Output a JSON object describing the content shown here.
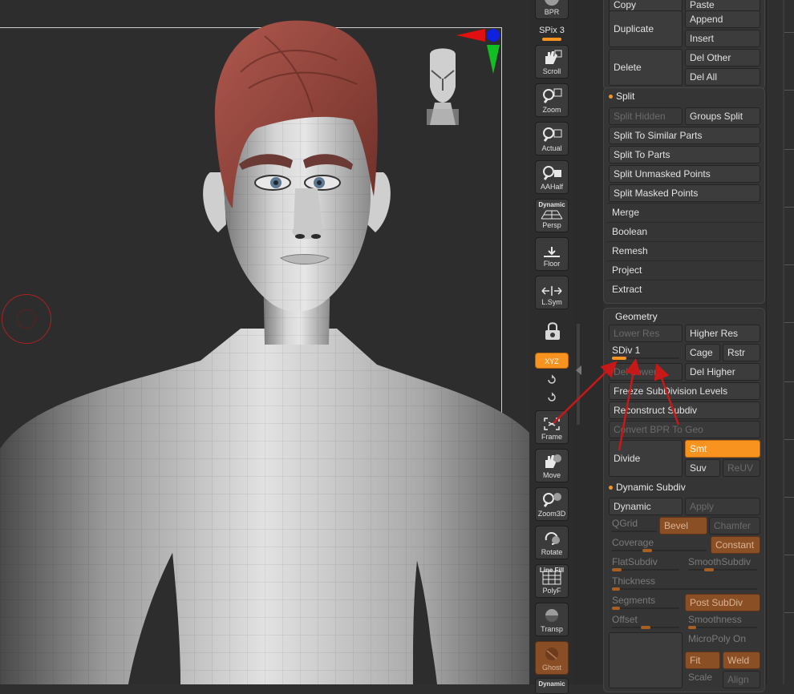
{
  "toolbar": {
    "bpr": "BPR",
    "spix": "SPix 3",
    "scroll": "Scroll",
    "zoom": "Zoom",
    "actual": "Actual",
    "aahalf": "AAHalf",
    "persp_top": "Dynamic",
    "persp": "Persp",
    "floor": "Floor",
    "lsym": "L.Sym",
    "xyz": "XYZ",
    "frame": "Frame",
    "move": "Move",
    "zoom3d": "Zoom3D",
    "rotate": "Rotate",
    "polyf_top": "Line Fill",
    "polyf": "PolyF",
    "transp": "Transp",
    "ghost": "Ghost",
    "dynamic_bottom": "Dynamic"
  },
  "tool": {
    "copy": "Copy",
    "paste": "Paste",
    "duplicate": "Duplicate",
    "append": "Append",
    "insert": "Insert",
    "delete": "Delete",
    "del_other": "Del Other",
    "del_all": "Del All",
    "split": {
      "title": "Split",
      "split_hidden": "Split Hidden",
      "groups_split": "Groups Split",
      "similar_parts": "Split To Similar Parts",
      "to_parts": "Split To Parts",
      "unmasked_points": "Split Unmasked Points",
      "masked_points": "Split Masked Points"
    },
    "items": [
      "Merge",
      "Boolean",
      "Remesh",
      "Project",
      "Extract"
    ],
    "geometry": {
      "title": "Geometry",
      "lower_res": "Lower Res",
      "higher_res": "Higher Res",
      "sdiv": "SDiv 1",
      "sdiv_level": 1,
      "cage": "Cage",
      "rstr": "Rstr",
      "del_lower": "Del Lower",
      "del_higher": "Del Higher",
      "freeze": "Freeze SubDivision Levels",
      "reconstruct": "Reconstruct Subdiv",
      "convert_bpr": "Convert BPR To Geo",
      "divide": "Divide",
      "smt": "Smt",
      "suv": "Suv",
      "reuv": "ReUV"
    },
    "dynamic_subdiv": {
      "title": "Dynamic Subdiv",
      "dynamic": "Dynamic",
      "apply": "Apply",
      "qgrid": "QGrid",
      "bevel": "Bevel",
      "chamfer": "Chamfer",
      "coverage": "Coverage",
      "constant": "Constant",
      "flatsubdiv": "FlatSubdiv",
      "smoothsubdiv": "SmoothSubdiv",
      "thickness": "Thickness",
      "segments": "Segments",
      "post_subdiv": "Post SubDiv",
      "offset": "Offset",
      "smoothness": "Smoothness",
      "micropoly": "MicroPoly On",
      "fit": "Fit",
      "weld": "Weld",
      "scale": "Scale",
      "align": "Align"
    }
  },
  "colors": {
    "accent": "#f7931e",
    "annotation_arrow": "#c81818",
    "hair": "#9a4d44",
    "skin": "#d8d8d8"
  }
}
